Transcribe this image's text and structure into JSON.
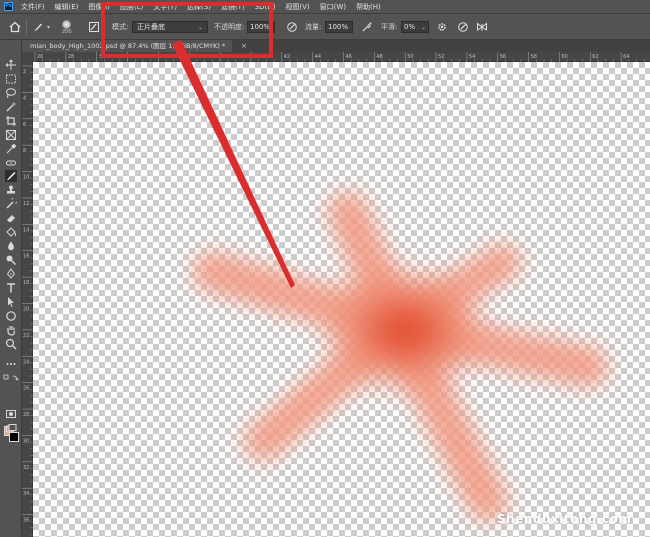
{
  "app": {
    "logo_text": "Ps"
  },
  "menu": [
    "文件(F)",
    "编辑(E)",
    "图像(I)",
    "图层(L)",
    "文字(Y)",
    "选择(S)",
    "滤镜(T)",
    "3D(D)",
    "视图(V)",
    "窗口(W)",
    "帮助(H)"
  ],
  "options": {
    "brush_size": "200",
    "mode_label": "模式:",
    "mode_value": "正片叠底",
    "opacity_label": "不透明度:",
    "opacity_value": "100%",
    "flow_label": "流量:",
    "flow_value": "100%",
    "smoothing_label": "平滑:",
    "smoothing_value": "0%"
  },
  "document_tab": {
    "title": "mian_body_High_1002.psd @ 87.4% (图层 1, RGB/8/CMYK) *",
    "close": "×"
  },
  "ruler_h": [
    "26",
    "28",
    "30",
    "32",
    "34",
    "36",
    "38",
    "40",
    "42",
    "44",
    "46",
    "48",
    "50",
    "52",
    "54",
    "56",
    "58",
    "60",
    "62",
    "64"
  ],
  "ruler_v": [
    "2",
    "4",
    "6",
    "8",
    "10",
    "12",
    "14",
    "16",
    "18",
    "20",
    "22",
    "24",
    "26",
    "28",
    "30",
    "32",
    "34",
    "36"
  ],
  "watermark": "Shenduxitong.com",
  "colors": {
    "foreground": "#f0a290",
    "background": "#000000",
    "highlight": "#dc2d2e",
    "ui_dark": "#535353"
  },
  "tools": [
    "move-icon",
    "marquee-icon",
    "lasso-icon",
    "magic-wand-icon",
    "crop-icon",
    "frame-icon",
    "eyedropper-icon",
    "healing-icon",
    "brush-icon",
    "stamp-icon",
    "history-brush-icon",
    "eraser-icon",
    "bucket-icon",
    "blur-icon",
    "dodge-icon",
    "pen-icon",
    "type-icon",
    "path-select-icon",
    "shape-icon",
    "hand-icon",
    "zoom-icon",
    "more-icon"
  ]
}
